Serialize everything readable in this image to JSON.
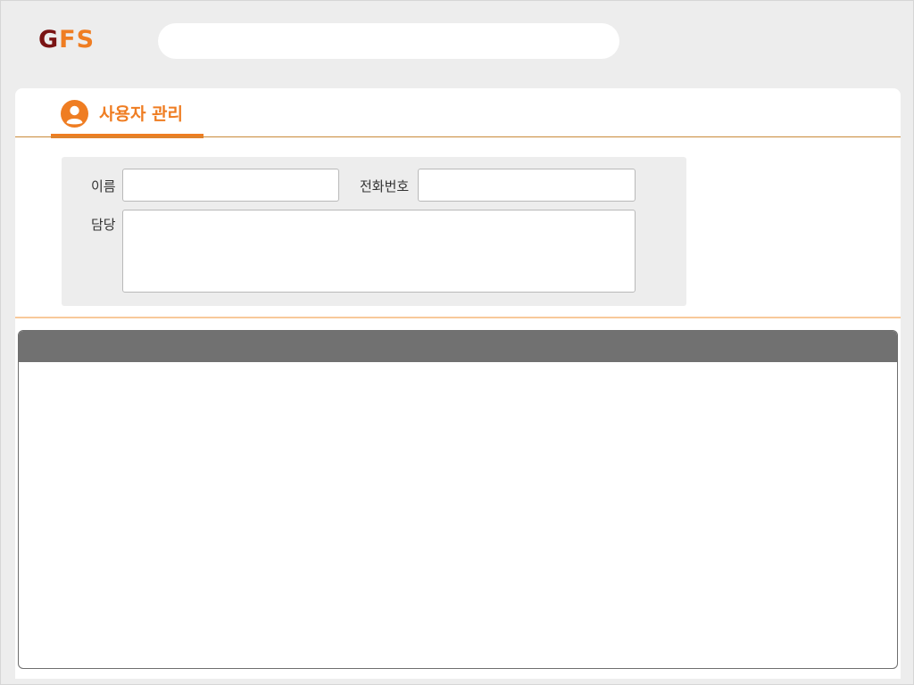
{
  "brand": {
    "logo_g": "G",
    "logo_fs": "FS",
    "colors": {
      "g": "#7a1414",
      "fs": "#ef7d22"
    }
  },
  "search": {
    "value": "",
    "placeholder": ""
  },
  "tab": {
    "label": "사용자 관리",
    "icon": "user-circle-icon",
    "accent": "#ef7d22"
  },
  "form": {
    "name_label": "이름",
    "name_value": "",
    "phone_label": "전화번호",
    "phone_value": "",
    "manager_label": "담당",
    "manager_value": ""
  },
  "grid": {
    "header_color": "#717171",
    "rows": []
  }
}
